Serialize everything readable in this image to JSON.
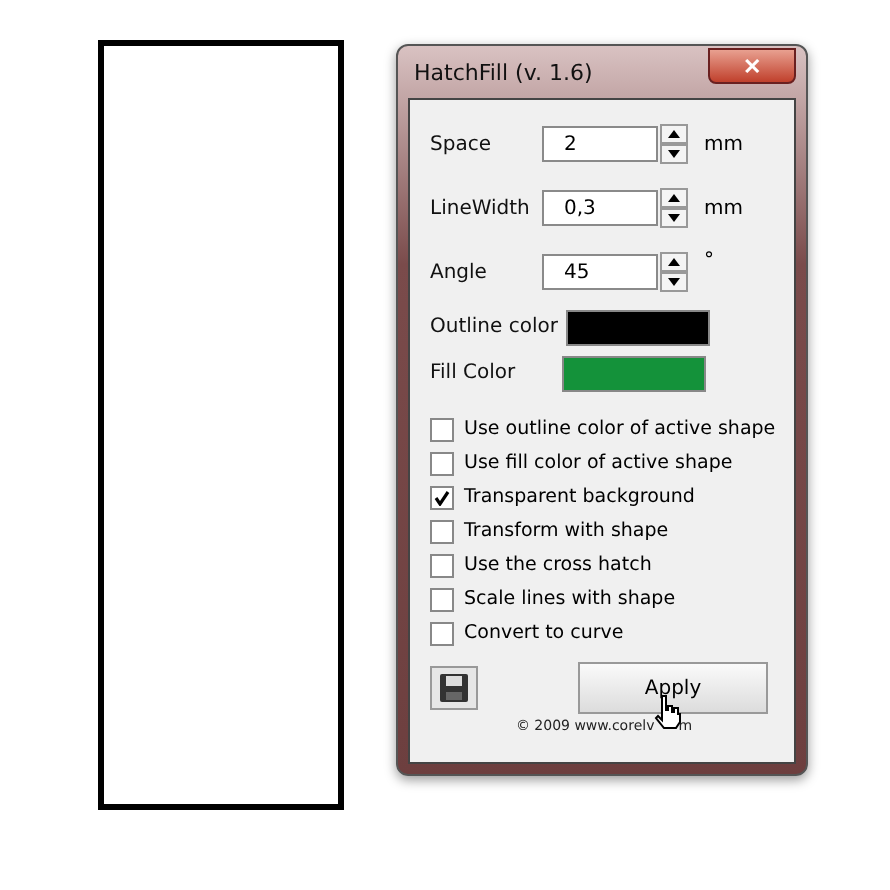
{
  "window": {
    "title": "HatchFill (v. 1.6)",
    "close_glyph": "✕"
  },
  "spinners": [
    {
      "label": "Space",
      "value": "2",
      "unit": "mm"
    },
    {
      "label": "LineWidth",
      "value": "0,3",
      "unit": "mm"
    },
    {
      "label": "Angle",
      "value": "45",
      "unit": "°"
    }
  ],
  "swatches": [
    {
      "label": "Outline color",
      "color": "#000000"
    },
    {
      "label": "Fill Color",
      "color": "#14923a"
    }
  ],
  "options": [
    {
      "label": "Use outline color of active shape",
      "checked": false
    },
    {
      "label": "Use fill color of active shape",
      "checked": false
    },
    {
      "label": "Transparent background",
      "checked": true
    },
    {
      "label": "Transform with shape",
      "checked": false
    },
    {
      "label": "Use the cross hatch",
      "checked": false
    },
    {
      "label": "Scale lines with shape",
      "checked": false
    },
    {
      "label": "Convert to curve",
      "checked": false
    }
  ],
  "apply_button": "Apply",
  "footer": {
    "before_cursor": "©  2009 www.corelv",
    "after_cursor": "m"
  }
}
